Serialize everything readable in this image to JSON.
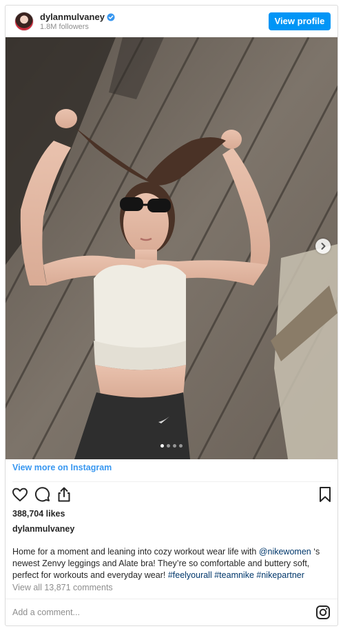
{
  "header": {
    "username": "dylanmulvaney",
    "followers": "1.8M followers",
    "view_profile_label": "View profile"
  },
  "post": {
    "view_more_label": "View more on Instagram",
    "likes": "388,704 likes",
    "caption_username": "dylanmulvaney",
    "caption_parts": {
      "p1": "Home for a moment and leaning into cozy workout wear life with ",
      "mention": "@nikewomen",
      "p2": " ‘s newest Zenvy leggings and Alate bra! They’re so comfortable and buttery soft, perfect for workouts and everyday wear! ",
      "tag1": "#feelyourall",
      "tag2": "#teamnike",
      "tag3": "#nikepartner"
    },
    "view_comments_label": "View all 13,871 comments",
    "add_comment_placeholder": "Add a comment...",
    "carousel": {
      "total": 4,
      "current": 1
    }
  },
  "icons": {
    "like": "heart-icon",
    "comment": "comment-icon",
    "share": "share-icon",
    "save": "bookmark-icon",
    "verified": "verified-badge-icon",
    "next": "chevron-right-icon",
    "brand": "instagram-icon"
  },
  "colors": {
    "accent": "#0095f6",
    "link": "#3897f0",
    "hashtag": "#00376b",
    "muted": "#8e8e8e"
  }
}
